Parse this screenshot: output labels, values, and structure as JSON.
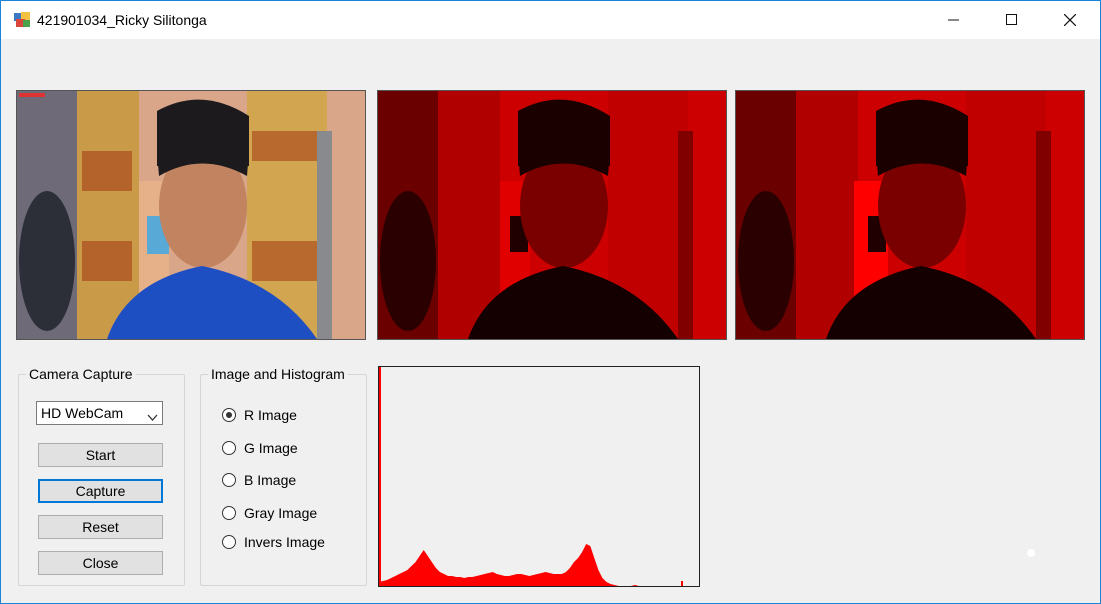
{
  "window": {
    "title": "421901034_Ricky Silitonga",
    "minimize_icon": "minimize-icon",
    "maximize_icon": "maximize-icon",
    "close_icon": "close-icon"
  },
  "images": {
    "original": {
      "icon": "webcam-photo"
    },
    "processed_1": {
      "icon": "red-channel-photo"
    },
    "processed_2": {
      "icon": "red-channel-photo"
    }
  },
  "camera_capture": {
    "label": "Camera Capture",
    "device_selected": "HD WebCam",
    "buttons": {
      "start": "Start",
      "capture": "Capture",
      "reset": "Reset",
      "close": "Close"
    }
  },
  "image_histogram": {
    "label": "Image and Histogram",
    "options": [
      {
        "label": "R Image",
        "checked": true
      },
      {
        "label": "G Image",
        "checked": false
      },
      {
        "label": "B Image",
        "checked": false
      },
      {
        "label": "Gray Image",
        "checked": false
      },
      {
        "label": "Invers Image",
        "checked": false
      }
    ]
  },
  "histogram": {
    "color": "#ff0000",
    "bins": [
      4,
      5,
      6,
      8,
      10,
      12,
      14,
      16,
      20,
      24,
      30,
      36,
      30,
      24,
      18,
      14,
      12,
      10,
      10,
      9,
      9,
      8,
      9,
      9,
      10,
      11,
      12,
      13,
      14,
      12,
      11,
      10,
      10,
      11,
      12,
      12,
      11,
      10,
      11,
      12,
      13,
      14,
      13,
      12,
      12,
      12,
      14,
      18,
      24,
      28,
      34,
      42,
      40,
      28,
      16,
      8,
      4,
      2,
      1,
      0,
      0,
      0,
      0,
      1,
      0
    ]
  },
  "colors": {
    "accent": "#0078d7",
    "red_channel": "#ff0000"
  }
}
